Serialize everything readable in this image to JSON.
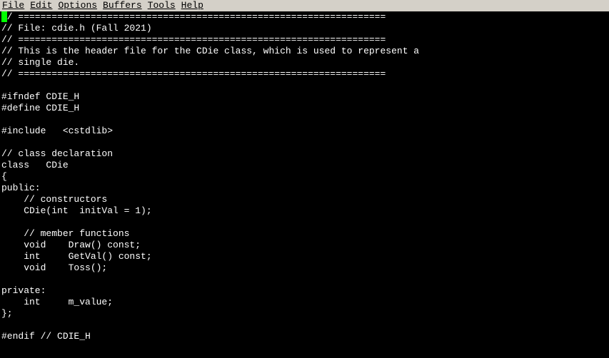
{
  "menubar": {
    "items": [
      "File",
      "Edit",
      "Options",
      "Buffers",
      "Tools",
      "Help"
    ]
  },
  "editor": {
    "lines": [
      "// ==================================================================",
      "// File: cdie.h (Fall 2021)",
      "// ==================================================================",
      "// This is the header file for the CDie class, which is used to represent a",
      "// single die.",
      "// ==================================================================",
      "",
      "#ifndef CDIE_H",
      "#define CDIE_H",
      "",
      "#include   <cstdlib>",
      "",
      "// class declaration",
      "class   CDie",
      "{",
      "public:",
      "    // constructors",
      "    CDie(int  initVal = 1);",
      "",
      "    // member functions",
      "    void    Draw() const;",
      "    int     GetVal() const;",
      "    void    Toss();",
      "",
      "private:",
      "    int     m_value;",
      "};",
      "",
      "#endif // CDIE_H"
    ]
  }
}
